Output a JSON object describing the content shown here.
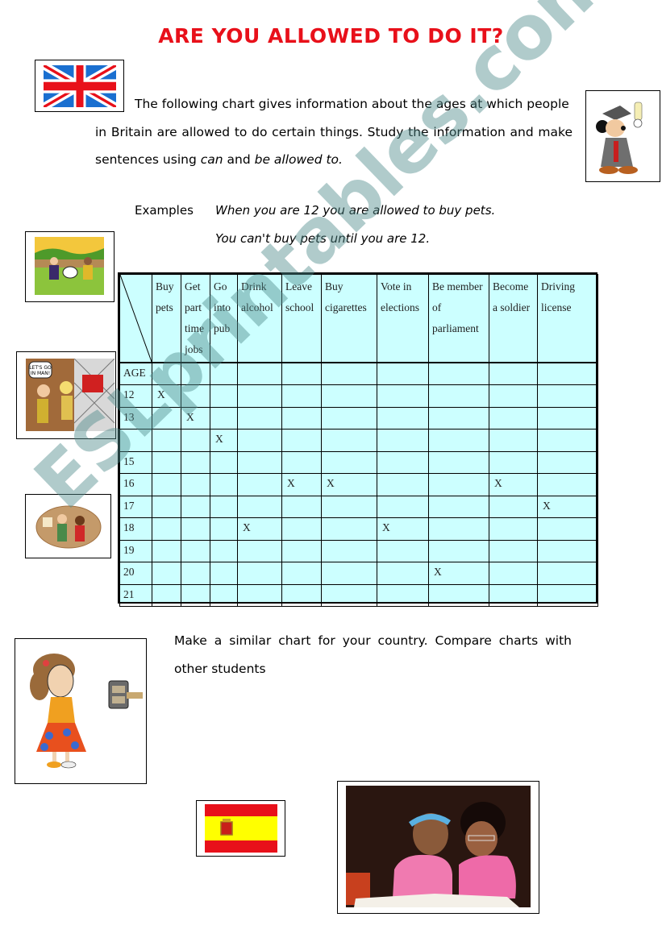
{
  "title": "ARE YOU ALLOWED TO DO IT?",
  "colors": {
    "title": "#e8101a",
    "table_fill": "#ccffff",
    "watermark": "#5f9e9e"
  },
  "intro": {
    "line1": "The following chart gives information about the ages at which people",
    "line2": "in Britain are allowed to do certain things. Study the information and make",
    "line3_prefix": "sentences using ",
    "line3_em1": "can",
    "line3_mid": " and ",
    "line3_em2": "be allowed to."
  },
  "examples": {
    "label": "Examples",
    "lines": [
      "When you are 12 you are allowed to buy pets.",
      "You can't buy pets  until you are 12."
    ]
  },
  "table": {
    "columns": [
      "Buy pets",
      "Get part time jobs",
      "Go into pub",
      "Drink alcohol",
      "Leave school",
      "Buy cigarettes",
      "Vote in elections",
      "Be member of parliament",
      "Become a soldier",
      "Driving license"
    ],
    "age_label": "AGE",
    "mark": "X",
    "rows": [
      {
        "age": "12",
        "marks": [
          1,
          0,
          0,
          0,
          0,
          0,
          0,
          0,
          0,
          0
        ]
      },
      {
        "age": "13",
        "marks": [
          0,
          1,
          0,
          0,
          0,
          0,
          0,
          0,
          0,
          0
        ]
      },
      {
        "age": "",
        "marks": [
          0,
          0,
          1,
          0,
          0,
          0,
          0,
          0,
          0,
          0
        ]
      },
      {
        "age": "15",
        "marks": [
          0,
          0,
          0,
          0,
          0,
          0,
          0,
          0,
          0,
          0
        ]
      },
      {
        "age": "16",
        "marks": [
          0,
          0,
          0,
          0,
          1,
          1,
          0,
          0,
          1,
          0
        ]
      },
      {
        "age": "17",
        "marks": [
          0,
          0,
          0,
          0,
          0,
          0,
          0,
          0,
          0,
          1
        ]
      },
      {
        "age": "18",
        "marks": [
          0,
          0,
          0,
          1,
          0,
          0,
          1,
          0,
          0,
          0
        ]
      },
      {
        "age": "19",
        "marks": [
          0,
          0,
          0,
          0,
          0,
          0,
          0,
          0,
          0,
          0
        ]
      },
      {
        "age": "20",
        "marks": [
          0,
          0,
          0,
          0,
          0,
          0,
          0,
          1,
          0,
          0
        ]
      },
      {
        "age": "21",
        "marks": [
          0,
          0,
          0,
          0,
          0,
          0,
          0,
          0,
          0,
          0
        ]
      }
    ]
  },
  "task": {
    "line1": "Make a similar chart for your country. Compare charts with",
    "line2": "other students"
  },
  "images": [
    "uk-flag",
    "mickey-graduate",
    "kids-with-dog",
    "lets-go-in-man-cartoon",
    "oval-cartoon",
    "girl-with-radio",
    "spain-flag",
    "girls-reading-photo"
  ],
  "watermark": "ESLprintables.com"
}
